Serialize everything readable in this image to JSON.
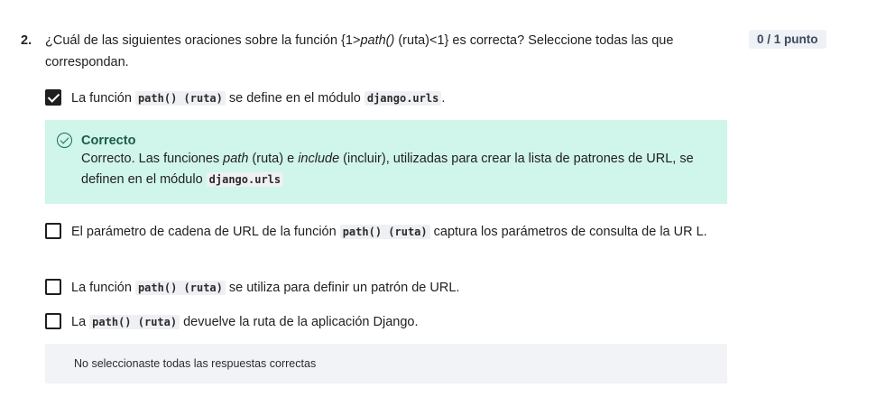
{
  "question": {
    "number": "2.",
    "text_before": "¿Cuál de las siguientes oraciones sobre la función {1>",
    "text_italic": "path()",
    "text_after": " (ruta)<1} es correcta? Seleccione todas las que correspondan.",
    "points": "0 / 1 punto"
  },
  "options": [
    {
      "checked": true,
      "pre": "La función ",
      "code": "path() (ruta)",
      "mid": " se define en el módulo ",
      "code2": "django.urls",
      "post": "."
    },
    {
      "checked": false,
      "pre": "El parámetro de cadena de URL de la función ",
      "code": "path() (ruta)",
      "post": " captura los parámetros de consulta de la UR L."
    },
    {
      "checked": false,
      "pre": "La función ",
      "code": "path() (ruta)",
      "post": " se utiliza para definir un patrón de URL."
    },
    {
      "checked": false,
      "pre": "La ",
      "code": "path() (ruta)",
      "post": " devuelve la ruta de la aplicación Django."
    }
  ],
  "feedback": {
    "title": "Correcto",
    "b1": "Correcto. Las funciones ",
    "i1": "path",
    "b2": " (ruta) e ",
    "i2": "include",
    "b3": " (incluir), utilizadas para crear la lista de patrones de URL, se definen en el módulo ",
    "code": "django.urls"
  },
  "result": {
    "text": "No seleccionaste todas las respuestas correctas"
  },
  "colors": {
    "feedback_bg": "#d0f5ea",
    "feedback_title": "#1a5c45",
    "badge_bg": "#eef1f5",
    "result_bg": "#f1f3f6"
  }
}
